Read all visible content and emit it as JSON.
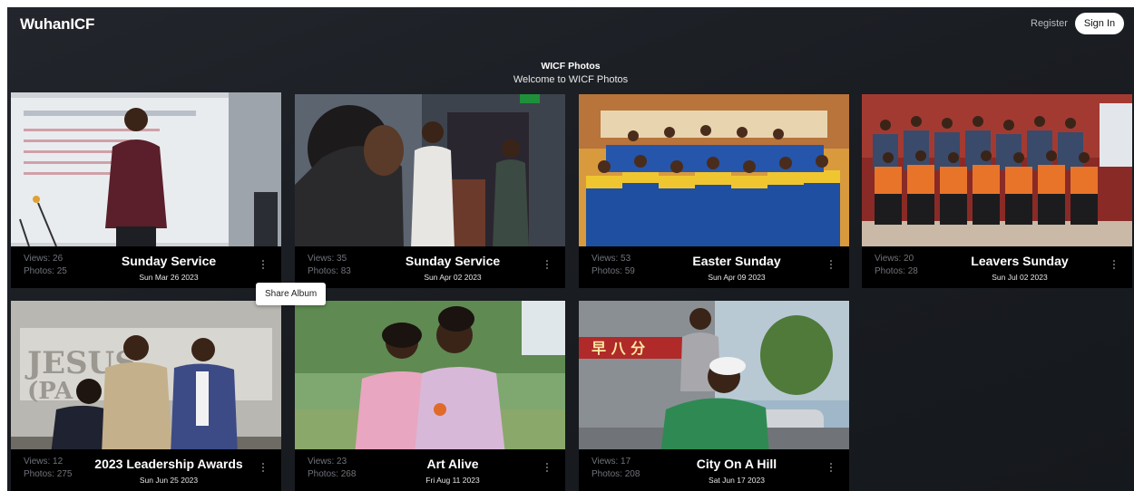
{
  "nav": {
    "brand": "WuhanICF",
    "register_label": "Register",
    "signin_label": "Sign In"
  },
  "header": {
    "title": "WICF Photos",
    "subtitle": "Welcome to WICF Photos"
  },
  "tooltip": {
    "label": "Share Album"
  },
  "albums": [
    {
      "title": "Sunday Service",
      "date": "Sun Mar 26 2023",
      "views": "Views: 26",
      "photos": "Photos: 25"
    },
    {
      "title": "Sunday Service",
      "date": "Sun Apr 02 2023",
      "views": "Views: 35",
      "photos": "Photos: 83"
    },
    {
      "title": "Easter Sunday",
      "date": "Sun Apr 09 2023",
      "views": "Views: 53",
      "photos": "Photos: 59"
    },
    {
      "title": "Leavers Sunday",
      "date": "Sun Jul 02 2023",
      "views": "Views: 20",
      "photos": "Photos: 28"
    },
    {
      "title": "2023 Leadership Awards",
      "date": "Sun Jun 25 2023",
      "views": "Views: 12",
      "photos": "Photos: 275"
    },
    {
      "title": "Art Alive",
      "date": "Fri Aug 11 2023",
      "views": "Views: 23",
      "photos": "Photos: 268"
    },
    {
      "title": "City On A Hill",
      "date": "Sat Jun 17 2023",
      "views": "Views: 17",
      "photos": "Photos: 208"
    }
  ],
  "icons": {
    "album_menu": "kebab-menu-icon"
  },
  "colors": {
    "background": "#1a1d22",
    "card_footer": "#000000",
    "muted_text": "#6f737a",
    "signin_bg": "#ffffff"
  }
}
